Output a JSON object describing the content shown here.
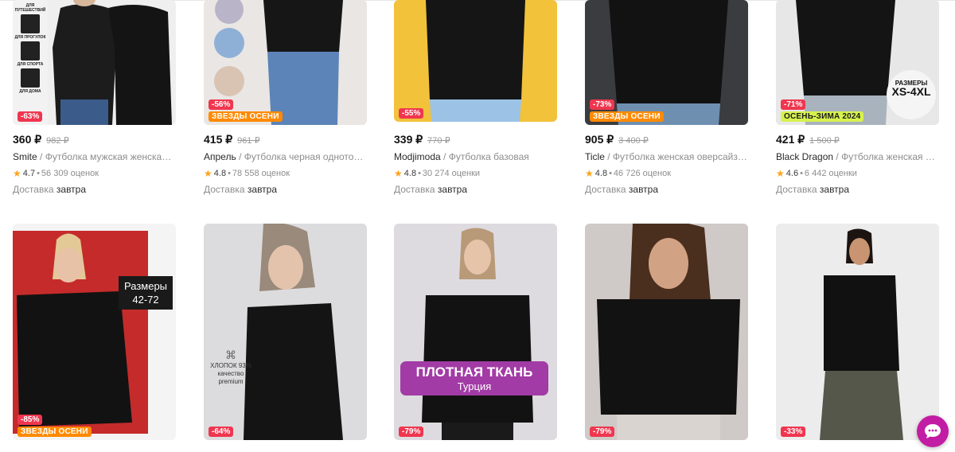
{
  "row1": [
    {
      "price": "360 ₽",
      "old_price": "982 ₽",
      "brand": "Smite",
      "name": "Футболка мужская женская о...",
      "rating": "4.7",
      "reviews": "56 309 оценок",
      "delivery_prefix": "Доставка",
      "delivery_day": "завтра",
      "discount": "-63%",
      "tag": "",
      "side_labels": [
        "ДЛЯ ПУТЕШЕСТВИЙ",
        "ДЛЯ ПРОГУЛОК",
        "ДЛЯ СПОРТА",
        "ДЛЯ ДОМА"
      ]
    },
    {
      "price": "415 ₽",
      "old_price": "961 ₽",
      "brand": "Апрель",
      "name": "Футболка черная однотонн...",
      "rating": "4.8",
      "reviews": "78 558 оценок",
      "delivery_prefix": "Доставка",
      "delivery_day": "завтра",
      "discount": "-56%",
      "tag": "ЗВЕЗДЫ ОСЕНИ"
    },
    {
      "price": "339 ₽",
      "old_price": "770 ₽",
      "brand": "Modjimoda",
      "name": "Футболка базовая",
      "rating": "4.8",
      "reviews": "30 274 оценки",
      "delivery_prefix": "Доставка",
      "delivery_day": "завтра",
      "discount": "-55%",
      "tag": ""
    },
    {
      "price": "905 ₽",
      "old_price": "3 400 ₽",
      "brand": "Ticle",
      "name": "Футболка женская оверсайз хл...",
      "rating": "4.8",
      "reviews": "46 726 оценок",
      "delivery_prefix": "Доставка",
      "delivery_day": "завтра",
      "discount": "-73%",
      "tag": "ЗВЕЗДЫ ОСЕНИ"
    },
    {
      "price": "421 ₽",
      "old_price": "1 500 ₽",
      "brand": "Black Dragon",
      "name": "Футболка женская ове...",
      "rating": "4.6",
      "reviews": "6 442 оценки",
      "delivery_prefix": "Доставка",
      "delivery_day": "завтра",
      "discount": "-71%",
      "tag": "ОСЕНЬ-ЗИМА 2024",
      "size_top": "РАЗМЕРЫ",
      "size_main": "XS-4XL"
    }
  ],
  "row2": [
    {
      "discount": "-85%",
      "tag": "ЗВЕЗДЫ ОСЕНИ",
      "overlay_line1": "Размеры",
      "overlay_line2": "42-72"
    },
    {
      "discount": "-64%",
      "tag": "",
      "cotton_line1": "ХЛОПОК 93%",
      "cotton_line2": "качество",
      "cotton_line3": "premium"
    },
    {
      "discount": "-79%",
      "tag": "",
      "overlay_line1": "ПЛОТНАЯ ТКАНЬ",
      "overlay_line2": "Турция"
    },
    {
      "discount": "-79%",
      "tag": ""
    },
    {
      "discount": "-33%",
      "tag": ""
    }
  ],
  "separator": "/",
  "star": "★",
  "dot": "•",
  "chat_icon": "chat-bubble-icon",
  "colors": {
    "accent_pink": "#f1117e",
    "stars_tag": "#ff8a00",
    "season_tag": "#d7f24e",
    "chat": "#c21ca4",
    "star": "#ffa31a"
  }
}
